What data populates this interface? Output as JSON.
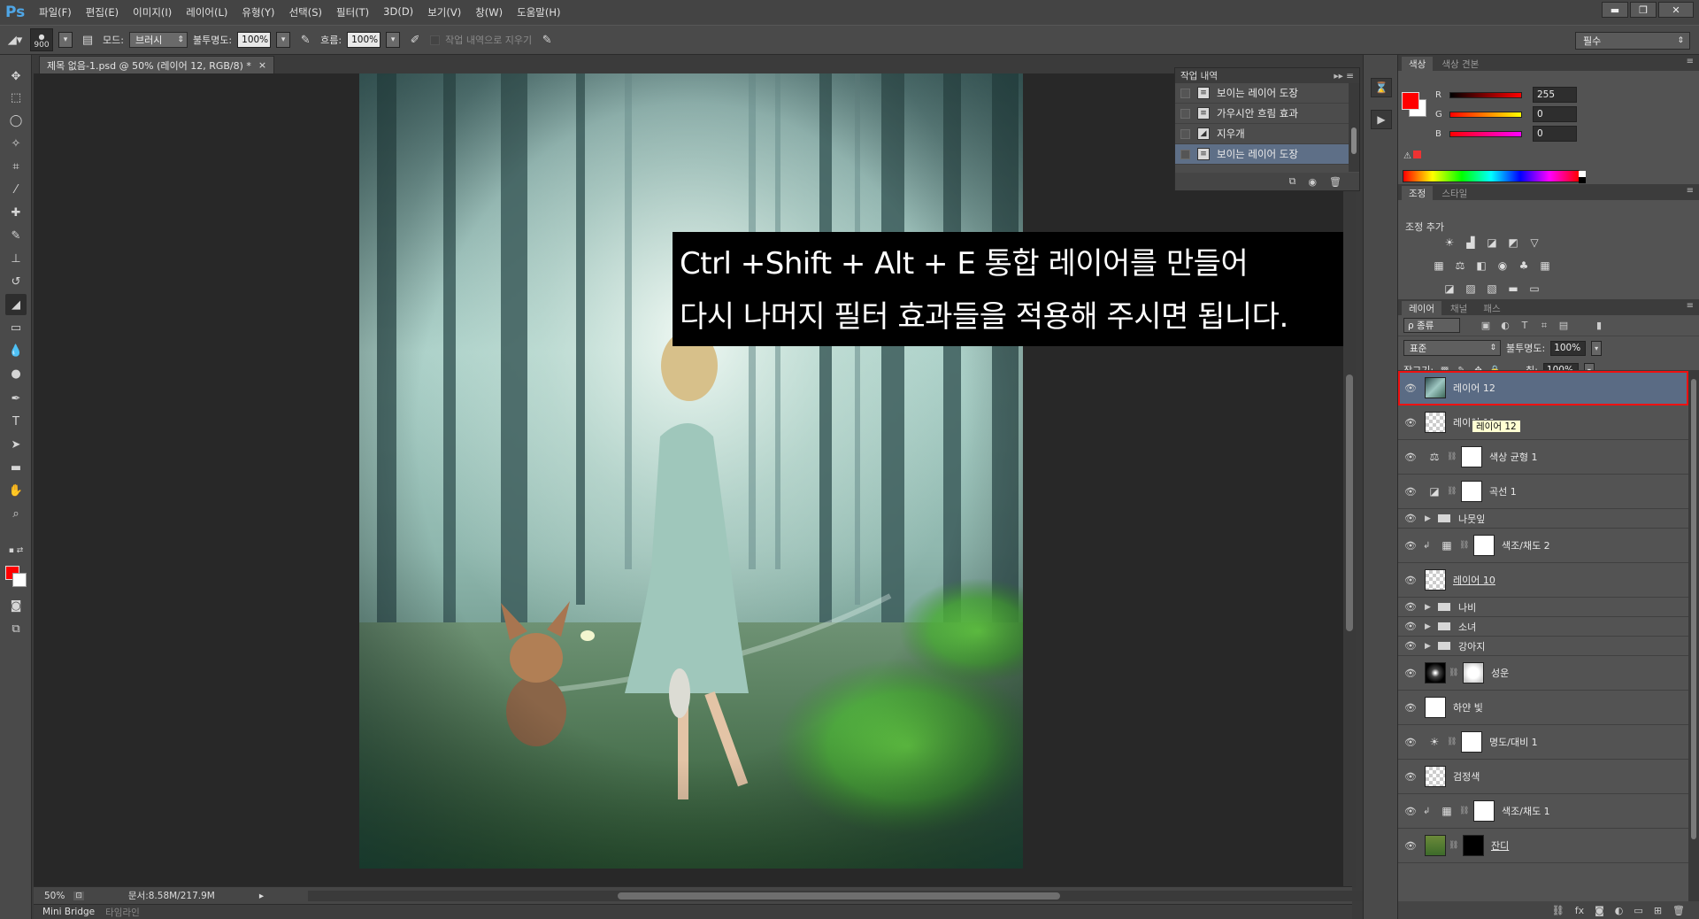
{
  "app": {
    "logo": "Ps"
  },
  "menu": [
    "파일(F)",
    "편집(E)",
    "이미지(I)",
    "레이어(L)",
    "유형(Y)",
    "선택(S)",
    "필터(T)",
    "3D(D)",
    "보기(V)",
    "창(W)",
    "도움말(H)"
  ],
  "window_controls": {
    "minimize": "▬",
    "restore": "❐",
    "close": "✕"
  },
  "options": {
    "brush_size": "900",
    "mode_label": "모드:",
    "mode_value": "브러시",
    "opacity_label": "불투명도:",
    "opacity_value": "100%",
    "flow_label": "흐름:",
    "flow_value": "100%",
    "erase_history_label": "작업 내역으로 지우기",
    "workspace": "필수"
  },
  "document": {
    "tab_title": "제목 없음-1.psd @ 50% (레이어 12, RGB/8) *",
    "tab_close": "×",
    "zoom": "50%",
    "doc_info": "문서:8.58M/217.9M"
  },
  "caption": {
    "line1": "Ctrl +Shift + Alt + E 통합 레이어를 만들어",
    "line2": "다시 나머지 필터 효과들을 적용해 주시면 됩니다."
  },
  "bottom_tabs": [
    "Mini Bridge",
    "타임라인"
  ],
  "history": {
    "title": "작업 내역",
    "items": [
      {
        "label": "보이는 레이어 도장",
        "icon": "document-icon",
        "selected": false
      },
      {
        "label": "가우시안 흐림 효과",
        "icon": "document-icon",
        "selected": false
      },
      {
        "label": "지우개",
        "icon": "eraser-icon",
        "selected": false
      },
      {
        "label": "보이는 레이어 도장",
        "icon": "document-icon",
        "selected": true
      }
    ]
  },
  "color_panel": {
    "tabs": [
      "색상",
      "색상 견본"
    ],
    "channels": [
      {
        "label": "R",
        "value": "255",
        "gradient": "#000000,#ff0000"
      },
      {
        "label": "G",
        "value": "0",
        "gradient": "#ff0000,#ffff00"
      },
      {
        "label": "B",
        "value": "0",
        "gradient": "#ff0000,#ff00ff"
      }
    ],
    "foreground": "#ff0000",
    "background": "#ffffff"
  },
  "adjustments_panel": {
    "tabs": [
      "조정",
      "스타일"
    ],
    "title": "조정 추가"
  },
  "layers_panel": {
    "tabs": [
      "레이어",
      "채널",
      "패스"
    ],
    "kind_filter": "ρ 종류",
    "blend_mode": "표준",
    "opacity_label": "불투명도:",
    "opacity_value": "100%",
    "lock_label": "잠그기:",
    "fill_label": "칠:",
    "fill_value": "100%",
    "tooltip": "레이어 12",
    "layers": [
      {
        "name": "레이어 12",
        "type": "pixel",
        "thumb": "forest",
        "selected": true
      },
      {
        "name": "레이어 11",
        "type": "pixel",
        "thumb": "checker"
      },
      {
        "name": "색상 균형 1",
        "type": "adjustment",
        "symbol": "⚖",
        "mask": "white"
      },
      {
        "name": "곡선 1",
        "type": "adjustment",
        "symbol": "◪",
        "mask": "white"
      },
      {
        "name": "나뭇잎",
        "type": "group"
      },
      {
        "name": "색조/채도 2",
        "type": "adjustment",
        "symbol": "▦",
        "mask": "white",
        "clipped": true
      },
      {
        "name": "레이어 10",
        "type": "pixel",
        "thumb": "checker",
        "underline": true
      },
      {
        "name": "나비",
        "type": "group"
      },
      {
        "name": "소녀",
        "type": "group"
      },
      {
        "name": "강아지",
        "type": "group"
      },
      {
        "name": "성운",
        "type": "pixel",
        "thumb": "nebula",
        "mask": "maskw"
      },
      {
        "name": "하얀 빛",
        "type": "pixel",
        "thumb": "white"
      },
      {
        "name": "명도/대비 1",
        "type": "adjustment",
        "symbol": "☀",
        "mask": "white"
      },
      {
        "name": "검정색",
        "type": "pixel",
        "thumb": "checker"
      },
      {
        "name": "색조/채도 1",
        "type": "adjustment",
        "symbol": "▦",
        "mask": "white",
        "clipped": true
      },
      {
        "name": "잔디",
        "type": "pixel",
        "thumb": "grass",
        "mask": "black",
        "underline": true
      }
    ]
  }
}
